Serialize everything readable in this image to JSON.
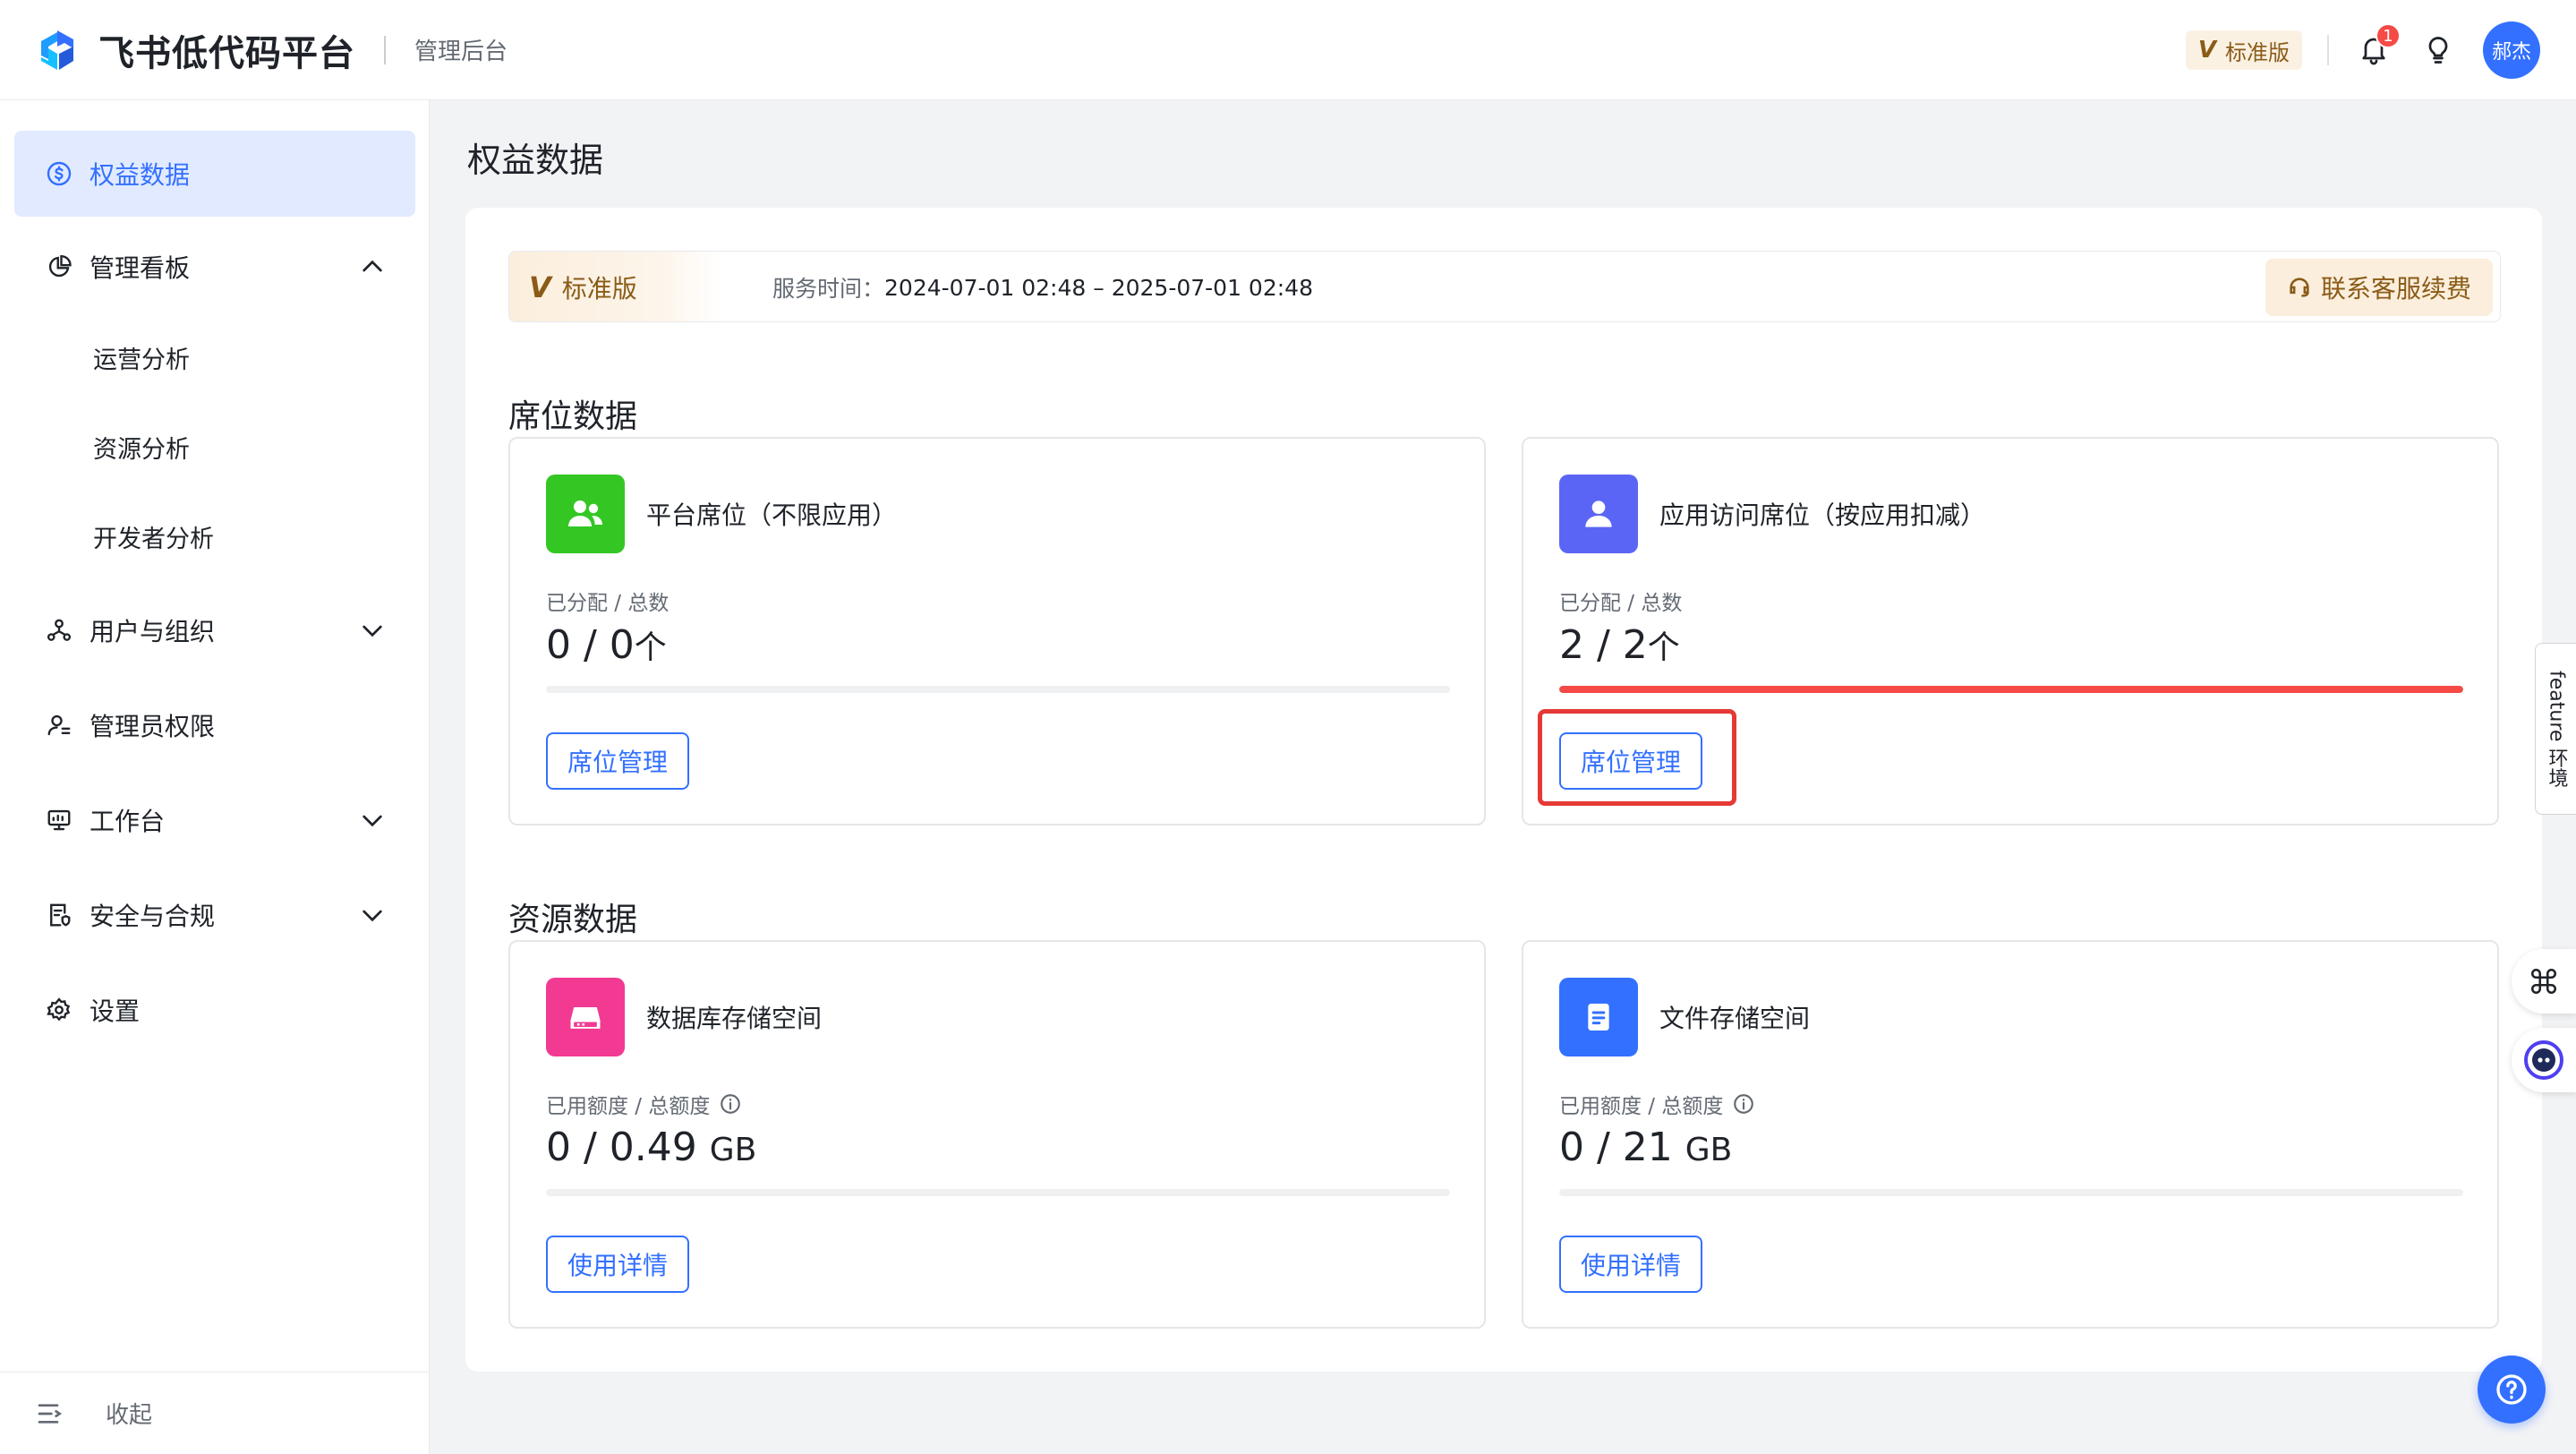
{
  "header": {
    "brand": "飞书低代码平台",
    "subtitle": "管理后台",
    "edition_badge": "标准版",
    "edition_v": "V",
    "notification_count": "1",
    "avatar_text": "郝杰"
  },
  "sidebar": {
    "items": [
      {
        "label": "权益数据",
        "icon": "dollar-circle-icon",
        "active": true
      },
      {
        "label": "管理看板",
        "icon": "pie-chart-icon",
        "expanded": true
      },
      {
        "label": "运营分析"
      },
      {
        "label": "资源分析"
      },
      {
        "label": "开发者分析"
      },
      {
        "label": "用户与组织",
        "icon": "org-icon"
      },
      {
        "label": "管理员权限",
        "icon": "admin-user-icon"
      },
      {
        "label": "工作台",
        "icon": "workbench-icon"
      },
      {
        "label": "安全与合规",
        "icon": "security-doc-icon"
      },
      {
        "label": "设置",
        "icon": "gear-icon"
      }
    ],
    "collapse_label": "收起"
  },
  "main": {
    "page_title": "权益数据",
    "service": {
      "edition": "标准版",
      "edition_v": "V",
      "time_label": "服务时间：",
      "time_value": "2024-07-01 02:48 – 2025-07-01 02:48",
      "renew_label": "联系客服续费"
    },
    "seat_section_title": "席位数据",
    "seat_cards": [
      {
        "title": "平台席位（不限应用）",
        "label": "已分配 / 总数",
        "value": "0 / 0",
        "unit": "个",
        "progress": 0,
        "button": "席位管理",
        "icon": "users-icon",
        "color": "#34c724"
      },
      {
        "title": "应用访问席位（按应用扣减）",
        "label": "已分配 / 总数",
        "value": "2 / 2",
        "unit": "个",
        "progress": 1.0,
        "button": "席位管理",
        "icon": "user-icon",
        "color": "#5b65f5"
      }
    ],
    "resource_section_title": "资源数据",
    "resource_cards": [
      {
        "title": "数据库存储空间",
        "label": "已用额度 / 总额度",
        "value": "0 / 0.49",
        "unit": "GB",
        "progress": 0,
        "button": "使用详情",
        "icon": "database-icon",
        "color": "#f23a93"
      },
      {
        "title": "文件存储空间",
        "label": "已用额度 / 总额度",
        "value": "0 / 21",
        "unit": "GB",
        "progress": 0,
        "button": "使用详情",
        "icon": "file-icon",
        "color": "#3370ff"
      }
    ]
  },
  "floating": {
    "feature_tab": "feature 环境"
  },
  "colors": {
    "primary": "#3370ff",
    "danger": "#f54a45",
    "gold": "#8a5b17"
  }
}
